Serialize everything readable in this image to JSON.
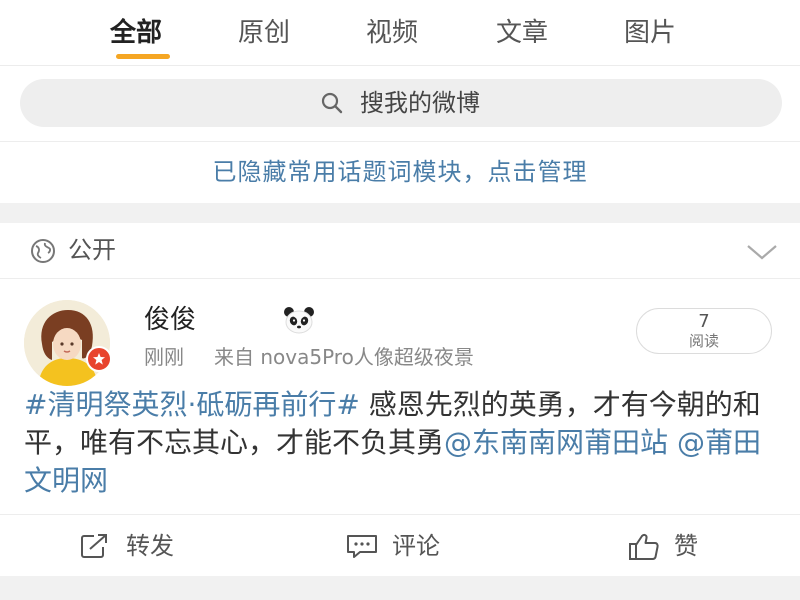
{
  "tabs": [
    {
      "label": "全部",
      "active": true
    },
    {
      "label": "原创",
      "active": false
    },
    {
      "label": "视频",
      "active": false
    },
    {
      "label": "文章",
      "active": false
    },
    {
      "label": "图片",
      "active": false
    }
  ],
  "search": {
    "placeholder": "搜我的微博"
  },
  "topic_notice": "已隐藏常用话题词模块，点击管理",
  "visibility": {
    "label": "公开"
  },
  "post": {
    "username": "俊俊",
    "time": "刚刚",
    "source": "来自 nova5Pro人像超级夜景",
    "read_count": "7",
    "read_label": "阅读",
    "topic": "#清明祭英烈·砥砺再前行#",
    "body": " 感恩先烈的英勇，才有今朝的和平，唯有不忘其心，才能不负其勇",
    "mention1": "@东南南网莆田站",
    "mention2": "@莆田文明网"
  },
  "actions": {
    "repost": "转发",
    "comment": "评论",
    "like": "赞"
  },
  "colors": {
    "accent": "#f5a623",
    "link": "#4a7da8",
    "badge": "#e8442e"
  },
  "icons": [
    "search-icon",
    "globe-icon",
    "chevron-down-icon",
    "panda-icon",
    "repost-icon",
    "comment-icon",
    "like-icon"
  ]
}
